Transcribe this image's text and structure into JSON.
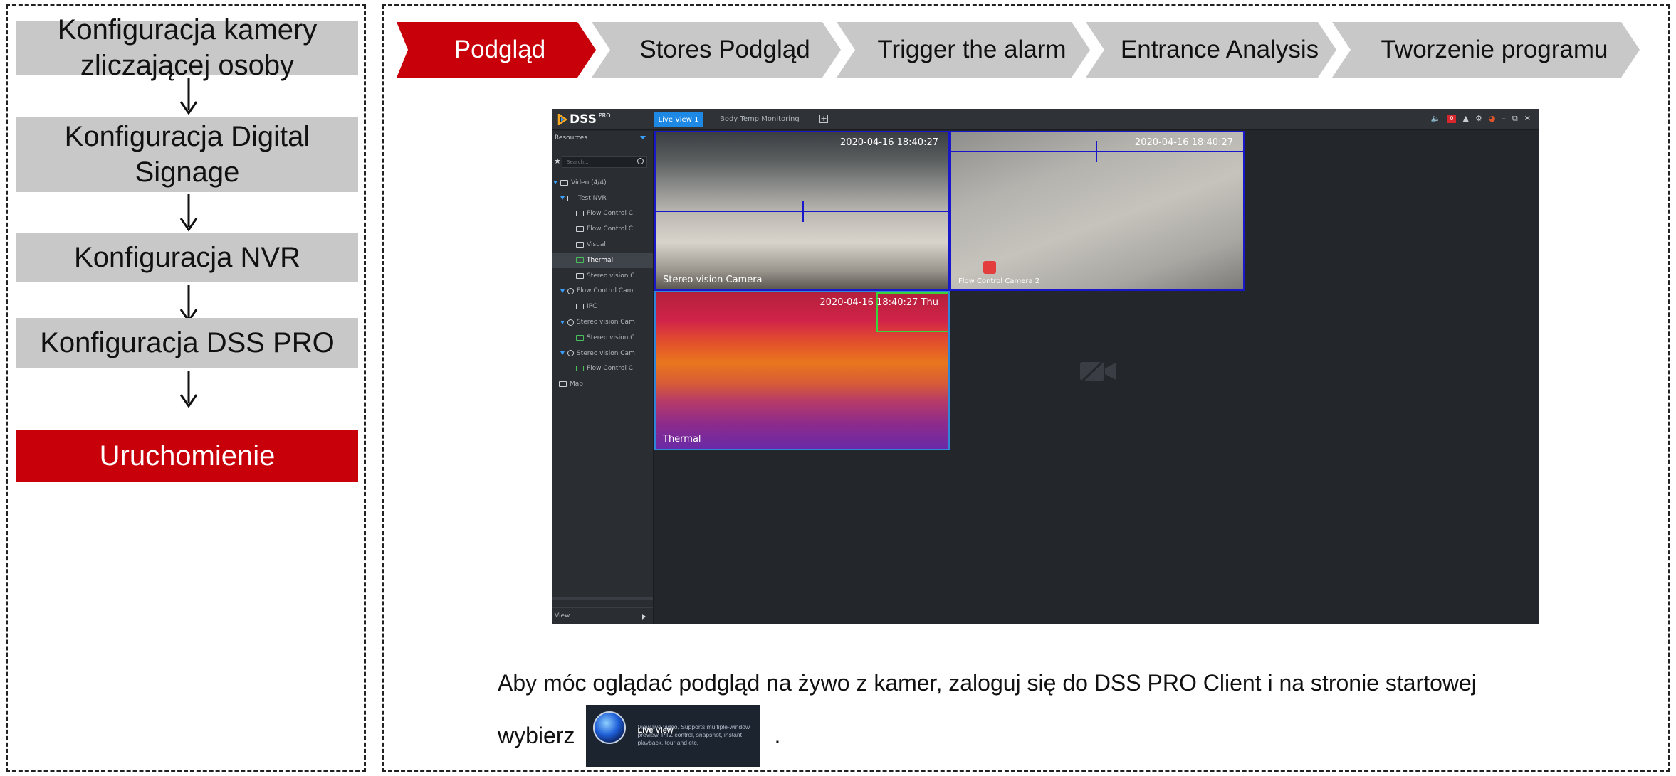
{
  "steps": [
    {
      "label": "Konfiguracja kamery zliczającej osoby",
      "active": false
    },
    {
      "label": "Konfiguracja Digital Signage",
      "active": false
    },
    {
      "label": "Konfiguracja NVR",
      "active": false
    },
    {
      "label": "Konfiguracja DSS PRO",
      "active": false
    },
    {
      "label": "Uruchomienie",
      "active": true
    }
  ],
  "tabs": [
    {
      "label": "Podgląd",
      "active": true
    },
    {
      "label": "Stores Podgląd",
      "active": false
    },
    {
      "label": "Trigger the alarm",
      "active": false
    },
    {
      "label": "Entrance Analysis",
      "active": false
    },
    {
      "label": "Tworzenie programu",
      "active": false
    }
  ],
  "colors": {
    "accent": "#c8000a",
    "step_bg": "#c8c8c8",
    "dss_bg": "#23262b",
    "dss_blue": "#1e88e5"
  },
  "dss": {
    "logo": "DSS",
    "logo_sup": "PRO",
    "tab_live": "Live View 1",
    "tab_body_temp": "Body Temp Monitoring",
    "add_tab": "+",
    "alarm_count": "0",
    "resources_label": "Resources",
    "search_placeholder": "Search...",
    "tree": [
      {
        "label": "Video (4/4)",
        "level": 0,
        "icon": "video-group-icon"
      },
      {
        "label": "Test NVR",
        "level": 1,
        "icon": "nvr-icon"
      },
      {
        "label": "Flow Control C",
        "level": 2,
        "icon": "camera-icon"
      },
      {
        "label": "Flow Control C",
        "level": 2,
        "icon": "camera-icon"
      },
      {
        "label": "Visual",
        "level": 2,
        "icon": "camera-icon"
      },
      {
        "label": "Thermal",
        "level": 2,
        "icon": "camera-icon",
        "selected": true
      },
      {
        "label": "Stereo vision C",
        "level": 2,
        "icon": "camera-icon"
      },
      {
        "label": "Flow Control Cam",
        "level": 1,
        "icon": "device-icon"
      },
      {
        "label": "IPC",
        "level": 2,
        "icon": "camera-icon"
      },
      {
        "label": "Stereo vision Cam",
        "level": 1,
        "icon": "device-icon"
      },
      {
        "label": "Stereo vision C",
        "level": 2,
        "icon": "camera-icon"
      },
      {
        "label": "Stereo vision Cam",
        "level": 1,
        "icon": "device-icon"
      },
      {
        "label": "Flow Control C",
        "level": 2,
        "icon": "camera-icon"
      },
      {
        "label": "Map",
        "level": 0,
        "icon": "map-icon"
      }
    ],
    "view_label": "View",
    "views": [
      {
        "timestamp": "2020-04-16 18:40:27",
        "caption": "Stereo vision Camera"
      },
      {
        "timestamp": "2020-04-16 18:40:27",
        "caption": "Flow Control Camera 2"
      },
      {
        "timestamp": "2020-04-16 18:40:27 Thu",
        "caption": "Thermal"
      },
      {
        "timestamp": "",
        "caption": ""
      }
    ]
  },
  "caption": {
    "line1": "Aby móc oglądać podgląd na żywo z kamer, zaloguj się do DSS PRO Client i na stronie startowej",
    "line2_prefix": "wybierz",
    "line2_suffix": "."
  },
  "live_view_card": {
    "title": "Live View",
    "description": "View live video. Supports multiple-window preview, PTZ control, snapshot, instant playback, tour and etc."
  }
}
